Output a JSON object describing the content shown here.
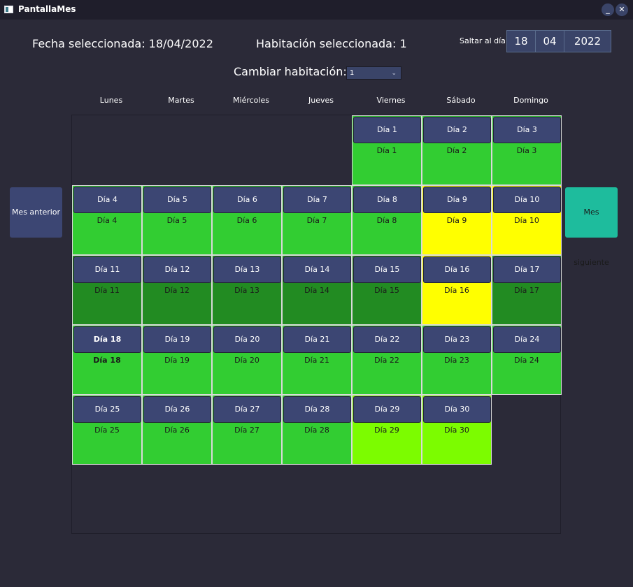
{
  "window": {
    "title": "PantallaMes"
  },
  "header": {
    "selected_date": "Fecha seleccionada: 18/04/2022",
    "selected_room": "Habitación seleccionada: 1",
    "jump_label": "Saltar al día:",
    "jump_day": "18",
    "jump_month": "04",
    "jump_year": "2022",
    "change_room_label": "Cambiar habitación:",
    "room_value": "1"
  },
  "weekdays": [
    "Lunes",
    "Martes",
    "Miércoles",
    "Jueves",
    "Viernes",
    "Sábado",
    "Domingo"
  ],
  "colors": {
    "available": "#32cd32",
    "occupied": "#228b22",
    "partial": "#ffff00",
    "light": "#7cfc00",
    "button": "#3c4673",
    "next_button": "#1ebc9d"
  },
  "days": [
    {
      "label": "Día 1",
      "weekday": 4,
      "week": 0,
      "status": "available"
    },
    {
      "label": "Día 2",
      "weekday": 5,
      "week": 0,
      "status": "available"
    },
    {
      "label": "Día 3",
      "weekday": 6,
      "week": 0,
      "status": "available"
    },
    {
      "label": "Día 4",
      "weekday": 0,
      "week": 1,
      "status": "available"
    },
    {
      "label": "Día 5",
      "weekday": 1,
      "week": 1,
      "status": "available"
    },
    {
      "label": "Día 6",
      "weekday": 2,
      "week": 1,
      "status": "available"
    },
    {
      "label": "Día 7",
      "weekday": 3,
      "week": 1,
      "status": "available"
    },
    {
      "label": "Día 8",
      "weekday": 4,
      "week": 1,
      "status": "available"
    },
    {
      "label": "Día 9",
      "weekday": 5,
      "week": 1,
      "status": "partial"
    },
    {
      "label": "Día 10",
      "weekday": 6,
      "week": 1,
      "status": "partial"
    },
    {
      "label": "Día 11",
      "weekday": 0,
      "week": 2,
      "status": "occupied"
    },
    {
      "label": "Día 12",
      "weekday": 1,
      "week": 2,
      "status": "occupied"
    },
    {
      "label": "Día 13",
      "weekday": 2,
      "week": 2,
      "status": "occupied"
    },
    {
      "label": "Día 14",
      "weekday": 3,
      "week": 2,
      "status": "occupied"
    },
    {
      "label": "Día 15",
      "weekday": 4,
      "week": 2,
      "status": "occupied"
    },
    {
      "label": "Día 16",
      "weekday": 5,
      "week": 2,
      "status": "partial"
    },
    {
      "label": "Día 17",
      "weekday": 6,
      "week": 2,
      "status": "occupied"
    },
    {
      "label": "Día 18",
      "weekday": 0,
      "week": 3,
      "status": "available",
      "selected": true
    },
    {
      "label": "Día 19",
      "weekday": 1,
      "week": 3,
      "status": "available"
    },
    {
      "label": "Día 20",
      "weekday": 2,
      "week": 3,
      "status": "available"
    },
    {
      "label": "Día 21",
      "weekday": 3,
      "week": 3,
      "status": "available"
    },
    {
      "label": "Día 22",
      "weekday": 4,
      "week": 3,
      "status": "available"
    },
    {
      "label": "Día 23",
      "weekday": 5,
      "week": 3,
      "status": "available"
    },
    {
      "label": "Día 24",
      "weekday": 6,
      "week": 3,
      "status": "available"
    },
    {
      "label": "Día 25",
      "weekday": 0,
      "week": 4,
      "status": "available"
    },
    {
      "label": "Día 26",
      "weekday": 1,
      "week": 4,
      "status": "available"
    },
    {
      "label": "Día 27",
      "weekday": 2,
      "week": 4,
      "status": "available"
    },
    {
      "label": "Día 28",
      "weekday": 3,
      "week": 4,
      "status": "available"
    },
    {
      "label": "Día 29",
      "weekday": 4,
      "week": 4,
      "status": "light"
    },
    {
      "label": "Día 30",
      "weekday": 5,
      "week": 4,
      "status": "light"
    }
  ],
  "nav": {
    "prev_label": "Mes anterior",
    "next_label": "Mes siguiente"
  }
}
